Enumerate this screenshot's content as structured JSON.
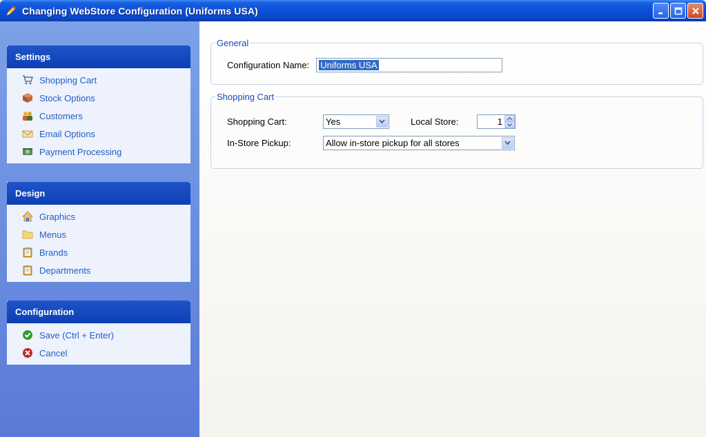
{
  "window": {
    "title": "Changing WebStore Configuration  (Uniforms USA)",
    "accent": "#0a4fd8"
  },
  "sidebar": {
    "settings": {
      "header": "Settings",
      "items": [
        {
          "label": "Shopping Cart",
          "icon": "shopping-cart-icon"
        },
        {
          "label": "Stock Options",
          "icon": "box-icon"
        },
        {
          "label": "Customers",
          "icon": "users-icon"
        },
        {
          "label": "Email Options",
          "icon": "envelope-icon"
        },
        {
          "label": "Payment Processing",
          "icon": "payment-icon"
        }
      ]
    },
    "design": {
      "header": "Design",
      "items": [
        {
          "label": "Graphics",
          "icon": "graphics-icon"
        },
        {
          "label": "Menus",
          "icon": "folder-icon"
        },
        {
          "label": "Brands",
          "icon": "clipboard-icon"
        },
        {
          "label": "Departments",
          "icon": "clipboard-icon"
        }
      ]
    },
    "configuration": {
      "header": "Configuration",
      "items": [
        {
          "label": "Save (Ctrl + Enter)",
          "icon": "check-icon"
        },
        {
          "label": "Cancel",
          "icon": "cancel-icon"
        }
      ]
    }
  },
  "general": {
    "legend": "General",
    "config_name_label": "Configuration Name:",
    "config_name_value": "Uniforms USA"
  },
  "shopping_cart": {
    "legend": "Shopping Cart",
    "cart_label": "Shopping Cart:",
    "cart_value": "Yes",
    "local_store_label": "Local Store:",
    "local_store_value": "1",
    "pickup_label": "In-Store Pickup:",
    "pickup_value": "Allow in-store pickup for all stores"
  }
}
